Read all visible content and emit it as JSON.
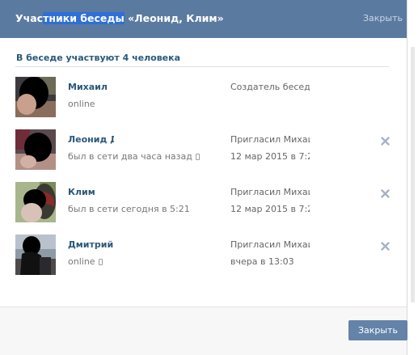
{
  "header": {
    "title_selected": "тники беседы",
    "title_prefix": "Учас",
    "title_suffix": " «Леонид, Клим»",
    "close_label": "Закрыть"
  },
  "members_count_label": "В беседе участвуют 4 человека",
  "members": [
    {
      "name": "Михаил",
      "status": "online",
      "mobile": false,
      "role": "Создатель беседы",
      "invited_by": "",
      "invite_date": "",
      "removable": false
    },
    {
      "name": "Леонид Д",
      "status": "был в сети два часа назад",
      "mobile": true,
      "role": "",
      "invited_by": "Пригласил Михаил З",
      "invite_date": "12 мар 2015 в 7:21",
      "removable": true
    },
    {
      "name": "Клим",
      "status": "был в сети сегодня в 5:21",
      "mobile": false,
      "role": "",
      "invited_by": "Пригласил Михаил",
      "invite_date": "12 мар 2015 в 7:21",
      "removable": true
    },
    {
      "name": "Дмитрий С",
      "status": "online",
      "mobile": true,
      "role": "",
      "invited_by": "Пригласил Михаил К",
      "invite_date": "вчера в 13:03",
      "removable": true
    }
  ],
  "footer": {
    "close_button_label": "Закрыть"
  },
  "colors": {
    "header_bg": "#5b7aa0",
    "link_blue": "#2b587a",
    "button_bg": "#6383a8"
  },
  "icons": [
    "close-x-icon",
    "mobile-phone-icon",
    "scrollbar"
  ]
}
